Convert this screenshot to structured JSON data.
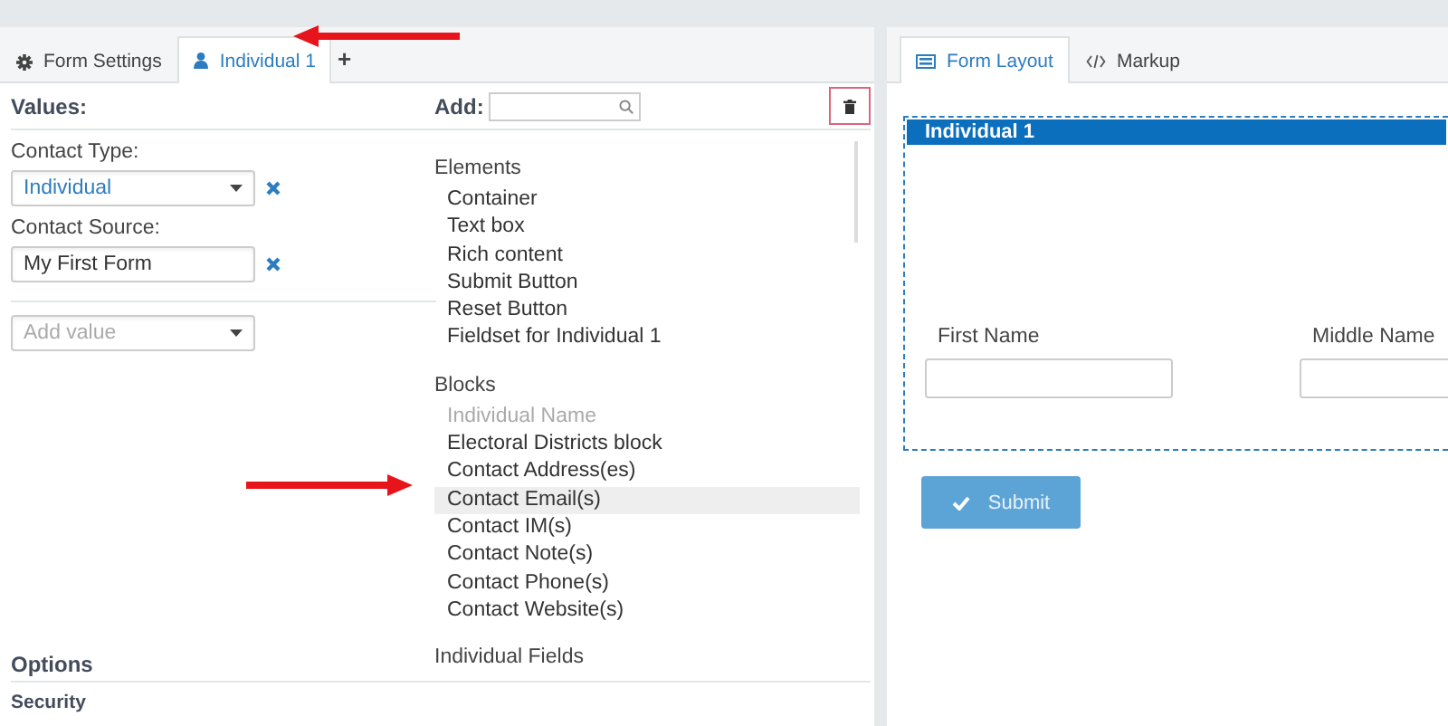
{
  "left_tabs": [
    {
      "label": "Form Settings",
      "selected": false
    },
    {
      "label": "Individual 1",
      "selected": true
    }
  ],
  "add_tab": "+",
  "values": {
    "heading": "Values:",
    "fields": [
      {
        "label": "Contact Type:",
        "kind": "select",
        "value": "Individual"
      },
      {
        "label": "Contact Source:",
        "kind": "text",
        "value": "My First Form"
      }
    ],
    "add_value": {
      "placeholder": "Add value"
    }
  },
  "palette": {
    "add_label": "Add:",
    "sections": [
      {
        "title": "Elements",
        "items": [
          {
            "label": "Container",
            "disabled": false,
            "selected": false
          },
          {
            "label": "Text box",
            "disabled": false,
            "selected": false
          },
          {
            "label": "Rich content",
            "disabled": false,
            "selected": false
          },
          {
            "label": "Submit Button",
            "disabled": false,
            "selected": false
          },
          {
            "label": "Reset Button",
            "disabled": false,
            "selected": false
          },
          {
            "label": "Fieldset for Individual 1",
            "disabled": false,
            "selected": false
          }
        ]
      },
      {
        "title": "Blocks",
        "items": [
          {
            "label": "Individual Name",
            "disabled": true,
            "selected": false
          },
          {
            "label": "Electoral Districts block",
            "disabled": false,
            "selected": false
          },
          {
            "label": "Contact Address(es)",
            "disabled": false,
            "selected": false
          },
          {
            "label": "Contact Email(s)",
            "disabled": false,
            "selected": true
          },
          {
            "label": "Contact IM(s)",
            "disabled": false,
            "selected": false
          },
          {
            "label": "Contact Note(s)",
            "disabled": false,
            "selected": false
          },
          {
            "label": "Contact Phone(s)",
            "disabled": false,
            "selected": false
          },
          {
            "label": "Contact Website(s)",
            "disabled": false,
            "selected": false
          }
        ]
      },
      {
        "title": "Individual Fields"
      }
    ]
  },
  "options": {
    "heading": "Options",
    "items": [
      "Security"
    ]
  },
  "right_tabs": [
    {
      "label": "Form Layout",
      "selected": true
    },
    {
      "label": "Markup",
      "selected": false
    }
  ],
  "fieldset": {
    "title": "Individual 1",
    "fields": [
      {
        "label": "First Name"
      },
      {
        "label": "Middle Name"
      }
    ]
  },
  "submit_button": "Submit"
}
